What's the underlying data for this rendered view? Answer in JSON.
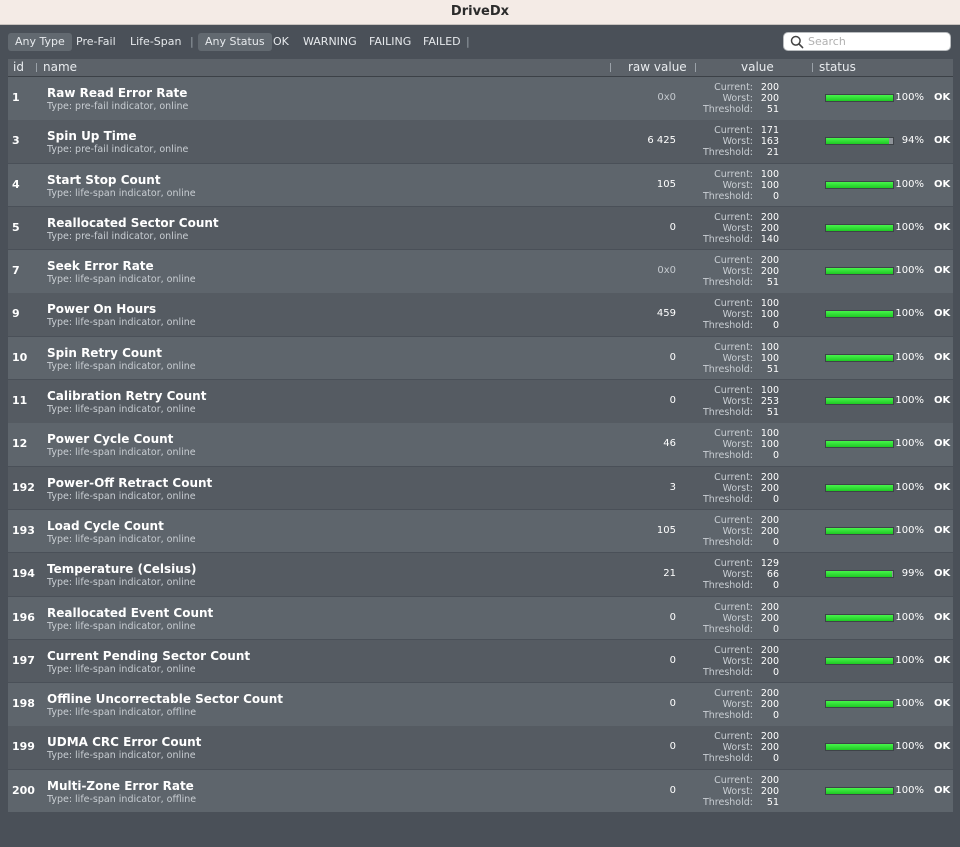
{
  "app": {
    "title": "DriveDx"
  },
  "filters": {
    "type_options": [
      "Any Type",
      "Pre-Fail",
      "Life-Span"
    ],
    "status_options": [
      "Any Status",
      "OK",
      "WARNING",
      "FAILING",
      "FAILED"
    ],
    "separator": "|",
    "active_type": "Any Type",
    "active_status": "Any Status"
  },
  "search": {
    "placeholder": "Search",
    "value": ""
  },
  "columns": {
    "id": "id",
    "name": "name",
    "raw_value": "raw value",
    "value": "value",
    "status": "status"
  },
  "value_labels": {
    "current": "Current:",
    "worst": "Worst:",
    "threshold": "Threshold:"
  },
  "colors": {
    "ok_bar": "#2ee832",
    "background": "#4a5058",
    "titlebar": "#f4ebe6"
  },
  "attributes": [
    {
      "id": "1",
      "name": "Raw Read Error Rate",
      "type": "Type: pre-fail indicator, online",
      "raw": "0x0",
      "raw_dim": true,
      "current": "200",
      "worst": "200",
      "threshold": "51",
      "percent": 100,
      "percent_label": "100%",
      "status": "OK"
    },
    {
      "id": "3",
      "name": "Spin Up Time",
      "type": "Type: pre-fail indicator, online",
      "raw": "6 425",
      "raw_dim": false,
      "current": "171",
      "worst": "163",
      "threshold": "21",
      "percent": 94,
      "percent_label": "94%",
      "status": "OK"
    },
    {
      "id": "4",
      "name": "Start Stop Count",
      "type": "Type: life-span indicator, online",
      "raw": "105",
      "raw_dim": false,
      "current": "100",
      "worst": "100",
      "threshold": "0",
      "percent": 100,
      "percent_label": "100%",
      "status": "OK"
    },
    {
      "id": "5",
      "name": "Reallocated Sector Count",
      "type": "Type: pre-fail indicator, online",
      "raw": "0",
      "raw_dim": false,
      "current": "200",
      "worst": "200",
      "threshold": "140",
      "percent": 100,
      "percent_label": "100%",
      "status": "OK"
    },
    {
      "id": "7",
      "name": "Seek Error Rate",
      "type": "Type: life-span indicator, online",
      "raw": "0x0",
      "raw_dim": true,
      "current": "200",
      "worst": "200",
      "threshold": "51",
      "percent": 100,
      "percent_label": "100%",
      "status": "OK"
    },
    {
      "id": "9",
      "name": "Power On Hours",
      "type": "Type: life-span indicator, online",
      "raw": "459",
      "raw_dim": false,
      "current": "100",
      "worst": "100",
      "threshold": "0",
      "percent": 100,
      "percent_label": "100%",
      "status": "OK"
    },
    {
      "id": "10",
      "name": "Spin Retry Count",
      "type": "Type: life-span indicator, online",
      "raw": "0",
      "raw_dim": false,
      "current": "100",
      "worst": "100",
      "threshold": "51",
      "percent": 100,
      "percent_label": "100%",
      "status": "OK"
    },
    {
      "id": "11",
      "name": "Calibration Retry Count",
      "type": "Type: life-span indicator, online",
      "raw": "0",
      "raw_dim": false,
      "current": "100",
      "worst": "253",
      "threshold": "51",
      "percent": 100,
      "percent_label": "100%",
      "status": "OK"
    },
    {
      "id": "12",
      "name": "Power Cycle Count",
      "type": "Type: life-span indicator, online",
      "raw": "46",
      "raw_dim": false,
      "current": "100",
      "worst": "100",
      "threshold": "0",
      "percent": 100,
      "percent_label": "100%",
      "status": "OK"
    },
    {
      "id": "192",
      "name": "Power-Off Retract Count",
      "type": "Type: life-span indicator, online",
      "raw": "3",
      "raw_dim": false,
      "current": "200",
      "worst": "200",
      "threshold": "0",
      "percent": 100,
      "percent_label": "100%",
      "status": "OK"
    },
    {
      "id": "193",
      "name": "Load Cycle Count",
      "type": "Type: life-span indicator, online",
      "raw": "105",
      "raw_dim": false,
      "current": "200",
      "worst": "200",
      "threshold": "0",
      "percent": 100,
      "percent_label": "100%",
      "status": "OK"
    },
    {
      "id": "194",
      "name": "Temperature (Celsius)",
      "type": "Type: life-span indicator, online",
      "raw": "21",
      "raw_dim": false,
      "current": "129",
      "worst": "66",
      "threshold": "0",
      "percent": 99,
      "percent_label": "99%",
      "status": "OK"
    },
    {
      "id": "196",
      "name": "Reallocated Event Count",
      "type": "Type: life-span indicator, online",
      "raw": "0",
      "raw_dim": false,
      "current": "200",
      "worst": "200",
      "threshold": "0",
      "percent": 100,
      "percent_label": "100%",
      "status": "OK"
    },
    {
      "id": "197",
      "name": "Current Pending Sector Count",
      "type": "Type: life-span indicator, online",
      "raw": "0",
      "raw_dim": false,
      "current": "200",
      "worst": "200",
      "threshold": "0",
      "percent": 100,
      "percent_label": "100%",
      "status": "OK"
    },
    {
      "id": "198",
      "name": "Offline Uncorrectable Sector Count",
      "type": "Type: life-span indicator, offline",
      "raw": "0",
      "raw_dim": false,
      "current": "200",
      "worst": "200",
      "threshold": "0",
      "percent": 100,
      "percent_label": "100%",
      "status": "OK"
    },
    {
      "id": "199",
      "name": "UDMA CRC Error Count",
      "type": "Type: life-span indicator, online",
      "raw": "0",
      "raw_dim": false,
      "current": "200",
      "worst": "200",
      "threshold": "0",
      "percent": 100,
      "percent_label": "100%",
      "status": "OK"
    },
    {
      "id": "200",
      "name": "Multi-Zone Error Rate",
      "type": "Type: life-span indicator, offline",
      "raw": "0",
      "raw_dim": false,
      "current": "200",
      "worst": "200",
      "threshold": "51",
      "percent": 100,
      "percent_label": "100%",
      "status": "OK"
    }
  ]
}
